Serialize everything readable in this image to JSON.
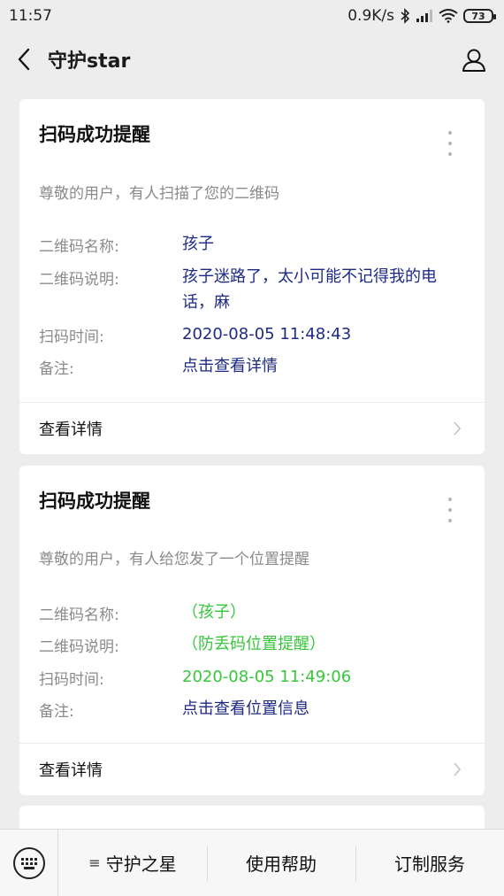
{
  "status_bar": {
    "time": "11:57",
    "speed": "0.9K/s",
    "battery": "73"
  },
  "nav": {
    "title": "守护star",
    "back_icon": "chevron-left-icon",
    "user_icon": "user-icon"
  },
  "cards": [
    {
      "title": "扫码成功提醒",
      "description": "尊敬的用户，有人扫描了您的二维码",
      "fields": [
        {
          "label": "二维码名称:",
          "value": "孩子"
        },
        {
          "label": "二维码说明:",
          "value": "孩子迷路了，太小可能不记得我的电话，麻"
        },
        {
          "label": "扫码时间:",
          "value": "2020-08-05 11:48:43"
        },
        {
          "label": "备注:",
          "value": "点击查看详情"
        }
      ],
      "detail_label": "查看详情"
    },
    {
      "title": "扫码成功提醒",
      "description": "尊敬的用户，有人给您发了一个位置提醒",
      "fields": [
        {
          "label": "二维码名称:",
          "value": "（孩子）"
        },
        {
          "label": "二维码说明:",
          "value": "（防丢码位置提醒）"
        },
        {
          "label": "扫码时间:",
          "value": "2020-08-05 11:49:06"
        },
        {
          "label": "备注:",
          "value": "点击查看位置信息"
        }
      ],
      "detail_label": "查看详情"
    }
  ],
  "colors": {
    "value_blue": "#1c2a86",
    "value_green": "#36c73a",
    "background": "#ededed"
  },
  "bottom_menu": {
    "keyboard_icon": "keyboard-icon",
    "menu_icon": "≡",
    "items": [
      "守护之星",
      "使用帮助",
      "订制服务"
    ]
  }
}
